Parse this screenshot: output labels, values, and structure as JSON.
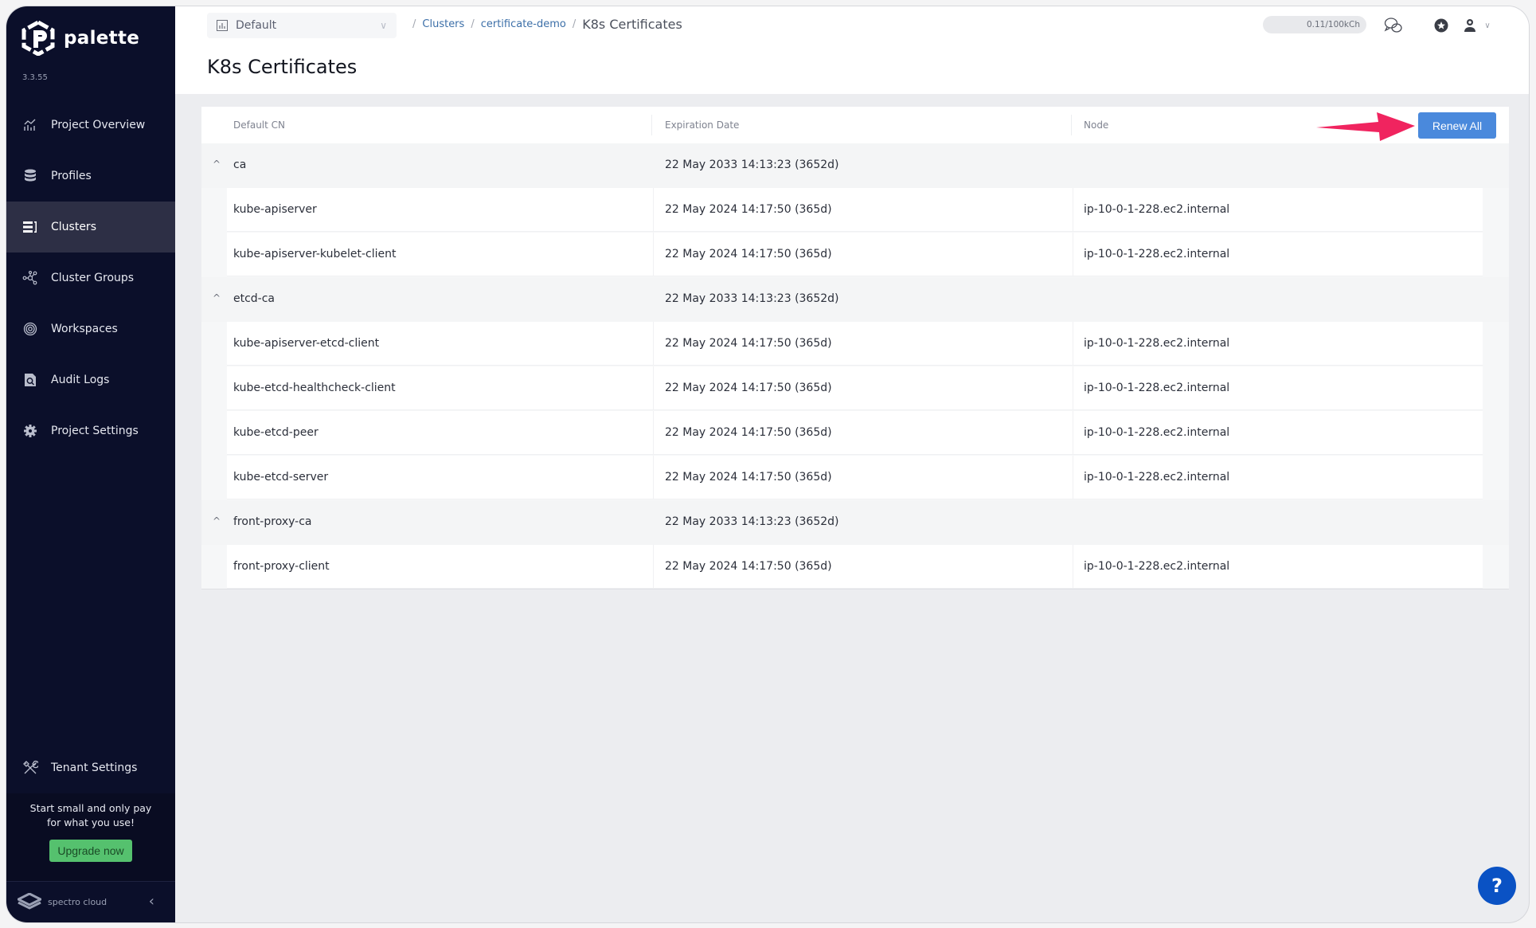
{
  "app": {
    "name": "palette",
    "version": "3.3.55"
  },
  "sidebar": {
    "items": [
      {
        "label": "Project Overview",
        "icon": "chart-icon",
        "active": false
      },
      {
        "label": "Profiles",
        "icon": "database-icon",
        "active": false
      },
      {
        "label": "Clusters",
        "icon": "clusters-icon",
        "active": true
      },
      {
        "label": "Cluster Groups",
        "icon": "cluster-groups-icon",
        "active": false
      },
      {
        "label": "Workspaces",
        "icon": "workspaces-icon",
        "active": false
      },
      {
        "label": "Audit Logs",
        "icon": "audit-logs-icon",
        "active": false
      },
      {
        "label": "Project Settings",
        "icon": "gear-icon",
        "active": false
      }
    ],
    "tenant_settings": "Tenant Settings",
    "promo_line1": "Start small and only pay",
    "promo_line2": "for what you use!",
    "upgrade_label": "Upgrade now",
    "footer_brand": "spectro cloud"
  },
  "header": {
    "scope": "Default",
    "breadcrumb": [
      "Clusters",
      "certificate-demo"
    ],
    "breadcrumb_current": "K8s Certificates",
    "usage": "0.11/100kCh",
    "page_title": "K8s Certificates"
  },
  "table": {
    "columns": [
      "Default CN",
      "Expiration Date",
      "Node"
    ],
    "renew_all_label": "Renew All",
    "groups": [
      {
        "name": "ca",
        "expiration": "22 May 2033 14:13:23 (3652d)",
        "children": [
          {
            "cn": "kube-apiserver",
            "expiration": "22 May 2024 14:17:50 (365d)",
            "node": "ip-10-0-1-228.ec2.internal"
          },
          {
            "cn": "kube-apiserver-kubelet-client",
            "expiration": "22 May 2024 14:17:50 (365d)",
            "node": "ip-10-0-1-228.ec2.internal"
          }
        ]
      },
      {
        "name": "etcd-ca",
        "expiration": "22 May 2033 14:13:23 (3652d)",
        "children": [
          {
            "cn": "kube-apiserver-etcd-client",
            "expiration": "22 May 2024 14:17:50 (365d)",
            "node": "ip-10-0-1-228.ec2.internal"
          },
          {
            "cn": "kube-etcd-healthcheck-client",
            "expiration": "22 May 2024 14:17:50 (365d)",
            "node": "ip-10-0-1-228.ec2.internal"
          },
          {
            "cn": "kube-etcd-peer",
            "expiration": "22 May 2024 14:17:50 (365d)",
            "node": "ip-10-0-1-228.ec2.internal"
          },
          {
            "cn": "kube-etcd-server",
            "expiration": "22 May 2024 14:17:50 (365d)",
            "node": "ip-10-0-1-228.ec2.internal"
          }
        ]
      },
      {
        "name": "front-proxy-ca",
        "expiration": "22 May 2033 14:13:23 (3652d)",
        "children": [
          {
            "cn": "front-proxy-client",
            "expiration": "22 May 2024 14:17:50 (365d)",
            "node": "ip-10-0-1-228.ec2.internal"
          }
        ]
      }
    ]
  },
  "help_label": "?",
  "colors": {
    "sidebar_bg": "#0b0f2a",
    "accent": "#4a89dc",
    "upgrade": "#55c16e",
    "arrow": "#f0245f",
    "help": "#0a52c4"
  }
}
